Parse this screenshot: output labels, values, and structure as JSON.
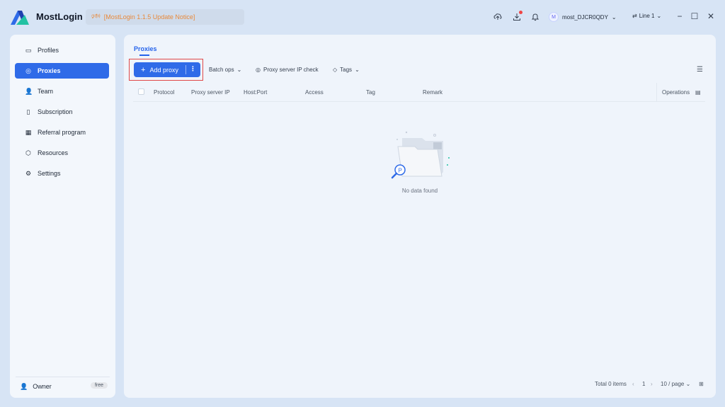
{
  "app": {
    "title": "MostLogin",
    "notice": "[MostLogin 1.1.5 Update Notice]"
  },
  "header": {
    "user_avatar": "M",
    "username": "most_DJCR0QDY",
    "line": "Line 1"
  },
  "sidebar": {
    "items": [
      {
        "label": "Profiles",
        "icon": "profiles-icon"
      },
      {
        "label": "Proxies",
        "icon": "proxies-icon",
        "active": true
      },
      {
        "label": "Team",
        "icon": "team-icon"
      },
      {
        "label": "Subscription",
        "icon": "subscription-icon"
      },
      {
        "label": "Referral program",
        "icon": "referral-icon"
      },
      {
        "label": "Resources",
        "icon": "resources-icon"
      },
      {
        "label": "Settings",
        "icon": "settings-icon"
      }
    ],
    "owner_label": "Owner",
    "plan_badge": "free"
  },
  "main": {
    "tab": "Proxies",
    "toolbar": {
      "add_label": "Add proxy",
      "batch_label": "Batch ops",
      "check_label": "Proxy server IP check",
      "tags_label": "Tags"
    },
    "columns": [
      "Protocol",
      "Proxy server IP",
      "Host:Port",
      "Access",
      "Tag",
      "Remark",
      "Operations"
    ],
    "empty_text": "No data found",
    "pagination": {
      "total": "Total 0 items",
      "current_page": "1",
      "page_size": "10 / page"
    }
  },
  "colors": {
    "accent": "#2f6be8",
    "notice": "#e8893a",
    "highlight": "#e04848"
  }
}
